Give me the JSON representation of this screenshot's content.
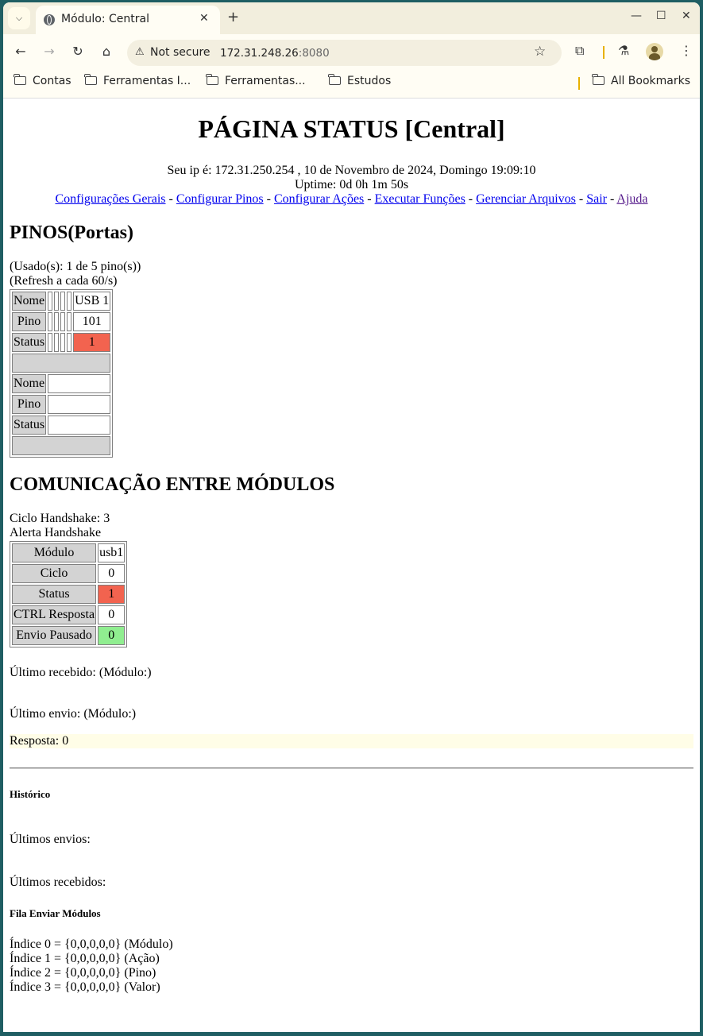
{
  "browser": {
    "tab_title": "Módulo: Central",
    "not_secure": "Not secure",
    "url_host": "172.31.248.26",
    "url_port": ":8080",
    "bookmarks": [
      "Contas",
      "Ferramentas I...",
      "Ferramentas...",
      "Estudos"
    ],
    "all_bookmarks": "All Bookmarks"
  },
  "page": {
    "title": "PÁGINA STATUS [Central]",
    "ip_line": "Seu ip é: 172.31.250.254 , 10 de Novembro de 2024, Domingo 19:09:10",
    "uptime": "Uptime: 0d 0h 1m 50s",
    "nav": [
      "Configurações Gerais",
      "Configurar Pinos",
      "Configurar Ações",
      "Executar Funções",
      "Gerenciar Arquivos",
      "Sair",
      "Ajuda"
    ],
    "nav_sep": "-",
    "pins": {
      "heading": "PINOS(Portas)",
      "used": "(Usado(s): 1 de 5 pino(s))",
      "refresh": "(Refresh a cada 60/s)",
      "row_labels": [
        "Nome",
        "Pino",
        "Status"
      ],
      "pin_name": "USB 1",
      "pin_number": "101",
      "pin_status": "1"
    },
    "comm": {
      "heading": "COMUNICAÇÃO ENTRE MÓDULOS",
      "cycle": "Ciclo Handshake: 3",
      "alert": "Alerta Handshake",
      "row_labels": [
        "Módulo",
        "Ciclo",
        "Status",
        "CTRL Resposta",
        "Envio Pausado"
      ],
      "values": [
        "usb1",
        "0",
        "1",
        "0",
        "0"
      ],
      "last_received": "Último recebido: (Módulo:)",
      "last_sent": "Último envio: (Módulo:)",
      "response": "Resposta: 0"
    },
    "history": {
      "heading": "Histórico",
      "last_sends": "Últimos envios:",
      "last_received": "Últimos recebidos:"
    },
    "queue": {
      "heading": "Fila Enviar Módulos",
      "lines": [
        "Índice 0 = {0,0,0,0,0} (Módulo)",
        "Índice 1 = {0,0,0,0,0} (Ação)",
        "Índice 2 = {0,0,0,0,0} (Pino)",
        "Índice 3 = {0,0,0,0,0} (Valor)"
      ]
    }
  }
}
